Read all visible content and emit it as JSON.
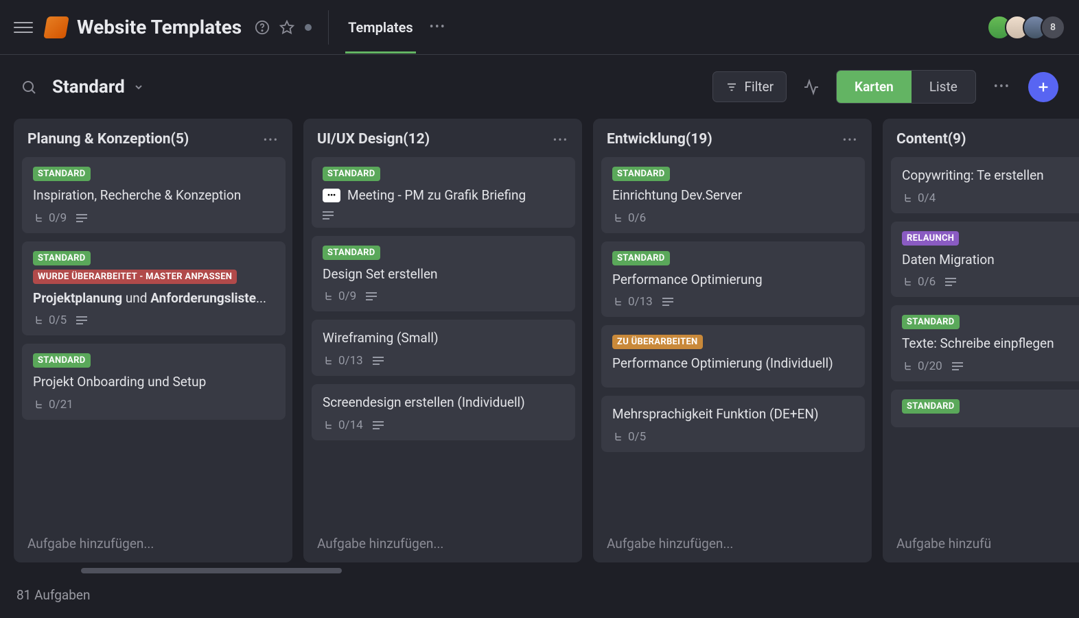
{
  "header": {
    "title": "Website Templates",
    "tab": "Templates",
    "avatar_count": "8"
  },
  "toolbar": {
    "view_name": "Standard",
    "filter": "Filter",
    "cards": "Karten",
    "list": "Liste"
  },
  "labels": {
    "standard": "STANDARD",
    "revised": "WURDE ÜBERARBEITET - MASTER ANPASSEN",
    "to_revise": "ZU ÜBERARBEITEN",
    "relaunch": "RELAUNCH"
  },
  "columns": [
    {
      "title": "Planung & Konzeption",
      "count": "(5)",
      "add": "Aufgabe hinzufügen...",
      "cards": [
        {
          "labels": [
            {
              "k": "standard",
              "cls": "green"
            }
          ],
          "title": "Inspiration, Recherche & Konzeption",
          "sub": "0/9",
          "desc": true
        },
        {
          "labels": [
            {
              "k": "standard",
              "cls": "green"
            },
            {
              "k": "revised",
              "cls": "red"
            }
          ],
          "title_html": "<span class='bold'>Projektplanung</span> und <span class='bold'>Anforderungsliste</span>...",
          "sub": "0/5",
          "desc": true
        },
        {
          "labels": [
            {
              "k": "standard",
              "cls": "green"
            }
          ],
          "title": "Projekt Onboarding und Setup",
          "sub": "0/21"
        }
      ]
    },
    {
      "title": "UI/UX Design",
      "count": "(12)",
      "add": "Aufgabe hinzufügen...",
      "cards": [
        {
          "labels": [
            {
              "k": "standard",
              "cls": "green"
            }
          ],
          "meeting": true,
          "title": "Meeting - PM zu Grafik Briefing",
          "desc_only": true
        },
        {
          "labels": [
            {
              "k": "standard",
              "cls": "green"
            }
          ],
          "title": "Design Set erstellen",
          "sub": "0/9",
          "desc": true
        },
        {
          "title": "Wireframing (Small)",
          "sub": "0/13",
          "desc": true
        },
        {
          "title": "Screendesign erstellen (Individuell)",
          "sub": "0/14",
          "desc": true
        }
      ]
    },
    {
      "title": "Entwicklung",
      "count": "(19)",
      "add": "Aufgabe hinzufügen...",
      "cards": [
        {
          "labels": [
            {
              "k": "standard",
              "cls": "green"
            }
          ],
          "title": "Einrichtung Dev.Server",
          "sub": "0/6"
        },
        {
          "labels": [
            {
              "k": "standard",
              "cls": "green"
            }
          ],
          "title": "Performance Optimierung",
          "sub": "0/13",
          "desc": true
        },
        {
          "labels": [
            {
              "k": "to_revise",
              "cls": "orange"
            }
          ],
          "title": "Performance Optimierung (Individuell)"
        },
        {
          "title": "Mehrsprachigkeit Funktion (DE+EN)",
          "sub": "0/5"
        }
      ]
    },
    {
      "title": "Content",
      "count": "(9)",
      "add": "Aufgabe hinzufü",
      "cards": [
        {
          "title": "Copywriting: Te erstellen",
          "sub": "0/4"
        },
        {
          "labels": [
            {
              "k": "relaunch",
              "cls": "purple"
            }
          ],
          "title": "Daten Migration",
          "sub": "0/6",
          "desc": true
        },
        {
          "labels": [
            {
              "k": "standard",
              "cls": "green"
            }
          ],
          "title": "Texte: Schreibe einpflegen",
          "sub": "0/20",
          "desc": true
        },
        {
          "labels": [
            {
              "k": "standard",
              "cls": "green"
            }
          ]
        }
      ]
    }
  ],
  "footer": {
    "count": "81 Aufgaben"
  }
}
